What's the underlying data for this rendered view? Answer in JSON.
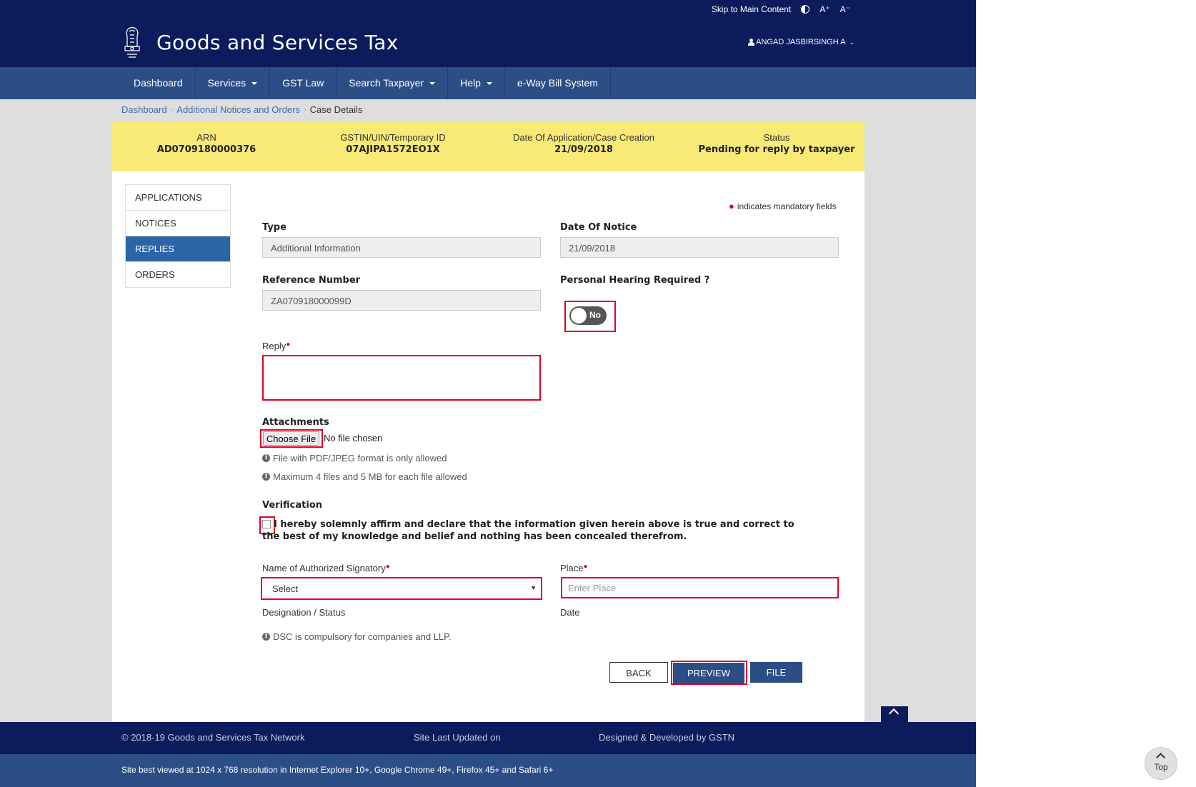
{
  "topbar": {
    "skip": "Skip to Main Content",
    "contrast_icon": "contrast-icon",
    "font_up": "A⁺",
    "font_down": "A⁻"
  },
  "header": {
    "title": "Goods and Services Tax",
    "user": "ANGAD JASBIRSINGH A"
  },
  "nav": {
    "items": [
      "Dashboard",
      "Services",
      "GST Law",
      "Search Taxpayer",
      "Help",
      "e-Way Bill System"
    ]
  },
  "breadcrumb": {
    "dashboard": "Dashboard",
    "notices": "Additional Notices and Orders",
    "current": "Case Details"
  },
  "summary": {
    "arn_label": "ARN",
    "arn": "AD0709180000376",
    "gstin_label": "GSTIN/UIN/Temporary ID",
    "gstin": "07AJIPA1572EO1X",
    "date_label": "Date Of Application/Case Creation",
    "date": "21/09/2018",
    "status_label": "Status",
    "status": "Pending for reply by taxpayer"
  },
  "sidenav": {
    "items": [
      "APPLICATIONS",
      "NOTICES",
      "REPLIES",
      "ORDERS"
    ],
    "active": "REPLIES"
  },
  "form": {
    "mandatory_note": "indicates mandatory fields",
    "type_label": "Type",
    "type_value": "Additional Information",
    "date_notice_label": "Date Of Notice",
    "date_notice_value": "21/09/2018",
    "ref_label": "Reference Number",
    "ref_value": "ZA070918000099D",
    "hearing_label": "Personal Hearing Required ?",
    "hearing_toggle": "No",
    "reply_label": "Reply",
    "attachments_label": "Attachments",
    "choose_file": "Choose File",
    "no_file": "No file chosen",
    "note1": "File with PDF/JPEG format is only allowed",
    "note2": "Maximum 4 files and 5 MB for each file allowed",
    "verification_label": "Verification",
    "verification_text": "I hereby solemnly affirm and declare that the information given herein above is true and correct to the best of my knowledge and belief and nothing has been concealed therefrom.",
    "signatory_label": "Name of Authorized Signatory",
    "signatory_value": "Select",
    "place_label": "Place",
    "place_placeholder": "Enter Place",
    "designation_label": "Designation / Status",
    "date_label": "Date",
    "dsc_note": "DSC is compulsory for companies and LLP."
  },
  "buttons": {
    "back": "BACK",
    "preview": "PREVIEW",
    "file": "FILE"
  },
  "footer": {
    "copyright": "© 2018-19 Goods and Services Tax Network",
    "updated": "Site Last Updated on",
    "designed": "Designed & Developed by GSTN",
    "best_viewed": "Site best viewed at 1024 x 768 resolution in Internet Explorer 10+, Google Chrome 49+, Firefox 45+ and Safari 6+"
  },
  "top_button": "Top",
  "colors": {
    "navy": "#0b1b5b",
    "nav_blue": "#2c4e86",
    "yellow": "#f9ea78",
    "active_blue": "#2c64a8",
    "required_red": "#e0002a"
  }
}
